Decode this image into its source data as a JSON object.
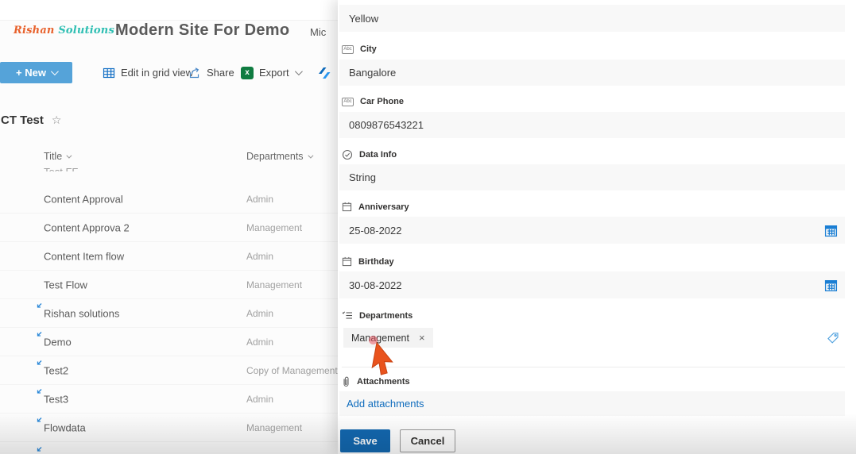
{
  "brand": {
    "part1": "Rishan",
    "part2": "Solutions"
  },
  "site_title": "Modern Site For Demo",
  "nav_partial": "Mic",
  "toolbar": {
    "new_label": "+ New",
    "edit_grid_label": "Edit in grid view",
    "share_label": "Share",
    "export_label": "Export"
  },
  "list": {
    "title": "CT Test",
    "star": "☆",
    "columns": {
      "title": "Title",
      "departments": "Departments"
    },
    "partial_row_text": "Test FF",
    "rows": [
      {
        "title": "Content Approval",
        "dept": "Admin"
      },
      {
        "title": "Content Approva 2",
        "dept": "Management"
      },
      {
        "title": "Content Item flow",
        "dept": "Admin"
      },
      {
        "title": "Test Flow",
        "dept": "Management"
      },
      {
        "title": "Rishan solutions",
        "dept": "Admin"
      },
      {
        "title": "Demo",
        "dept": "Admin"
      },
      {
        "title": "Test2",
        "dept": "Copy of Management"
      },
      {
        "title": "Test3",
        "dept": "Admin"
      },
      {
        "title": "Flowdata",
        "dept": "Management"
      }
    ]
  },
  "panel": {
    "top_field_value": "Yellow",
    "city": {
      "label": "City",
      "value": "Bangalore"
    },
    "car_phone": {
      "label": "Car Phone",
      "value": "0809876543221"
    },
    "data_info": {
      "label": "Data Info",
      "value": "String"
    },
    "anniversary": {
      "label": "Anniversary",
      "value": "25-08-2022"
    },
    "birthday": {
      "label": "Birthday",
      "value": "30-08-2022"
    },
    "departments": {
      "label": "Departments",
      "chip": "Management",
      "remove": "×"
    },
    "attachments": {
      "label": "Attachments",
      "add_link": "Add attachments"
    },
    "buttons": {
      "save": "Save",
      "cancel": "Cancel"
    }
  },
  "icons": {
    "abc_label": "Abc",
    "excel_glyph": "x"
  },
  "colors": {
    "accent_blue": "#0f6cbd",
    "new_button_blue": "#55a3d9",
    "save_button_blue": "#1368b0",
    "excel_green": "#107c41",
    "logo_orange": "#e8622d",
    "logo_teal": "#2fbfb3",
    "cursor_orange": "#e9531d",
    "date_icon_blue": "#1b7fd4",
    "tag_icon_blue": "#54a4e0",
    "row_flag_blue": "#2b88d8"
  }
}
